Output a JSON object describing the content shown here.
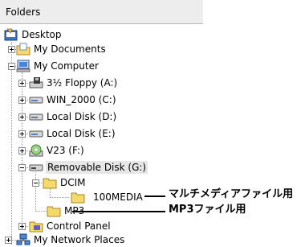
{
  "header": {
    "title": "Folders"
  },
  "tree": {
    "desktop": "Desktop",
    "my_documents": "My Documents",
    "my_computer": "My Computer",
    "floppy": "3½ Floppy (A:)",
    "win2000": "WIN_2000 (C:)",
    "local_d": "Local Disk (D:)",
    "local_e": "Local Disk (E:)",
    "v23": "V23 (F:)",
    "removable": "Removable Disk (G:)",
    "dcim": "DCIM",
    "media100": "100MEDIA",
    "mp3": "MP3",
    "control_panel": "Control Panel",
    "network": "My Network Places"
  },
  "callouts": {
    "multimedia": "マルチメディアファイル用",
    "mp3": "MP3ファイル用"
  }
}
